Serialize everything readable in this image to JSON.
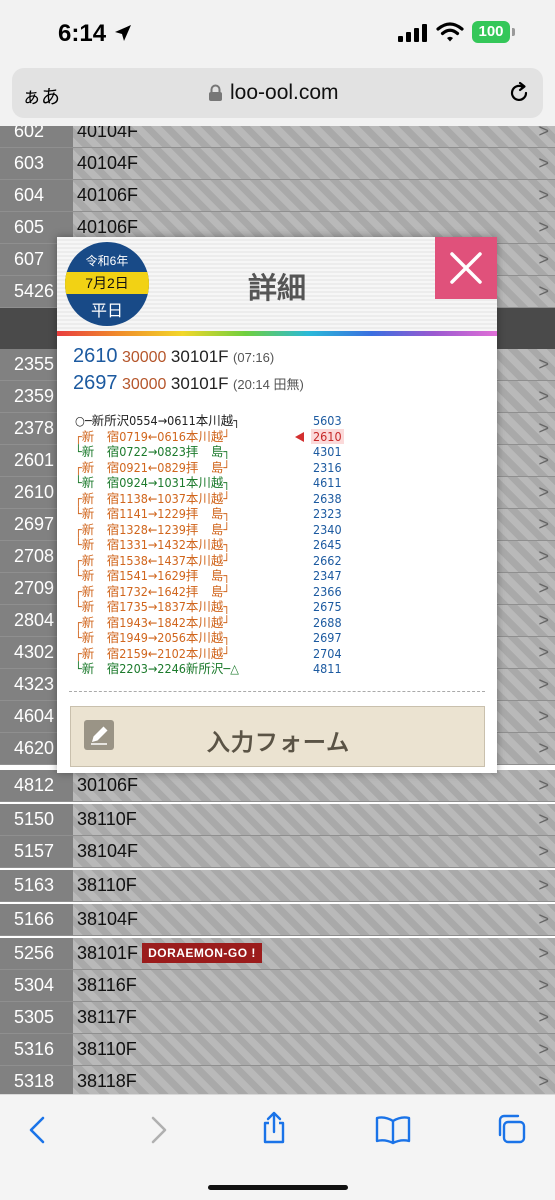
{
  "status": {
    "time": "6:14",
    "battery": "100"
  },
  "browser": {
    "aa": "ぁあ",
    "domain": "loo-ool.com"
  },
  "list": {
    "rows_top": [
      {
        "num": "602",
        "car": "40104F"
      },
      {
        "num": "603",
        "car": "40104F"
      },
      {
        "num": "604",
        "car": "40106F"
      },
      {
        "num": "605",
        "car": "40106F"
      },
      {
        "num": "607",
        "car": ""
      },
      {
        "num": "5426",
        "car": ""
      }
    ],
    "rows_mid": [
      {
        "num": "2355",
        "car": ""
      },
      {
        "num": "2359",
        "car": ""
      },
      {
        "num": "2378",
        "car": ""
      },
      {
        "num": "2601",
        "car": ""
      },
      {
        "num": "2610",
        "car": ""
      },
      {
        "num": "2697",
        "car": ""
      },
      {
        "num": "2708",
        "car": ""
      },
      {
        "num": "2709",
        "car": ""
      },
      {
        "num": "2804",
        "car": ""
      },
      {
        "num": "4302",
        "car": ""
      },
      {
        "num": "4323",
        "car": ""
      },
      {
        "num": "4604",
        "car": ""
      },
      {
        "num": "4620",
        "car": ""
      },
      {
        "num": "4812",
        "car": "30106F"
      },
      {
        "num": "5150",
        "car": "38110F"
      },
      {
        "num": "5157",
        "car": "38104F"
      },
      {
        "num": "5163",
        "car": "38110F"
      },
      {
        "num": "5166",
        "car": "38104F"
      },
      {
        "num": "5256",
        "car": "38101F"
      },
      {
        "num": "5304",
        "car": "38116F"
      },
      {
        "num": "5305",
        "car": "38117F"
      },
      {
        "num": "5316",
        "car": "38110F"
      },
      {
        "num": "5318",
        "car": "38118F"
      }
    ],
    "badge_text": "DORAEMON-GO !"
  },
  "modal": {
    "era": "令和6年",
    "day": "7月2日",
    "day_type": "平日",
    "title": "詳細",
    "trains": [
      {
        "num": "2610",
        "formation": "30000",
        "car": "30101F",
        "note": "(07:16)"
      },
      {
        "num": "2697",
        "formation": "30000",
        "car": "30101F",
        "note": "(20:14 田無)"
      }
    ],
    "schedule": [
      {
        "route": "○─新所沢0554→0611本川越┐",
        "color": "black",
        "num": "5603",
        "current": false
      },
      {
        "route": "┌新　宿0719←0616本川越┘",
        "color": "orange",
        "num": "2610",
        "current": true
      },
      {
        "route": "└新　宿0722→0823拝　島┐",
        "color": "green",
        "num": "4301",
        "current": false
      },
      {
        "route": "┌新　宿0921←0829拝　島┘",
        "color": "orange",
        "num": "2316",
        "current": false
      },
      {
        "route": "└新　宿0924→1031本川越┐",
        "color": "green",
        "num": "4611",
        "current": false
      },
      {
        "route": "┌新　宿1138←1037本川越┘",
        "color": "orange",
        "num": "2638",
        "current": false
      },
      {
        "route": "└新　宿1141→1229拝　島┐",
        "color": "orange",
        "num": "2323",
        "current": false
      },
      {
        "route": "┌新　宿1328←1239拝　島┘",
        "color": "orange",
        "num": "2340",
        "current": false
      },
      {
        "route": "└新　宿1331→1432本川越┐",
        "color": "orange",
        "num": "2645",
        "current": false
      },
      {
        "route": "┌新　宿1538←1437本川越┘",
        "color": "orange",
        "num": "2662",
        "current": false
      },
      {
        "route": "└新　宿1541→1629拝　島┐",
        "color": "orange",
        "num": "2347",
        "current": false
      },
      {
        "route": "┌新　宿1732←1642拝　島┘",
        "color": "orange",
        "num": "2366",
        "current": false
      },
      {
        "route": "└新　宿1735→1837本川越┐",
        "color": "orange",
        "num": "2675",
        "current": false
      },
      {
        "route": "┌新　宿1943←1842本川越┘",
        "color": "orange",
        "num": "2688",
        "current": false
      },
      {
        "route": "└新　宿1949→2056本川越┐",
        "color": "orange",
        "num": "2697",
        "current": false
      },
      {
        "route": "┌新　宿2159←2102本川越┘",
        "color": "orange",
        "num": "2704",
        "current": false
      },
      {
        "route": "└新　宿2203→2246新所沢─△",
        "color": "green",
        "num": "4811",
        "current": false
      }
    ],
    "input_button": "入力フォーム"
  }
}
